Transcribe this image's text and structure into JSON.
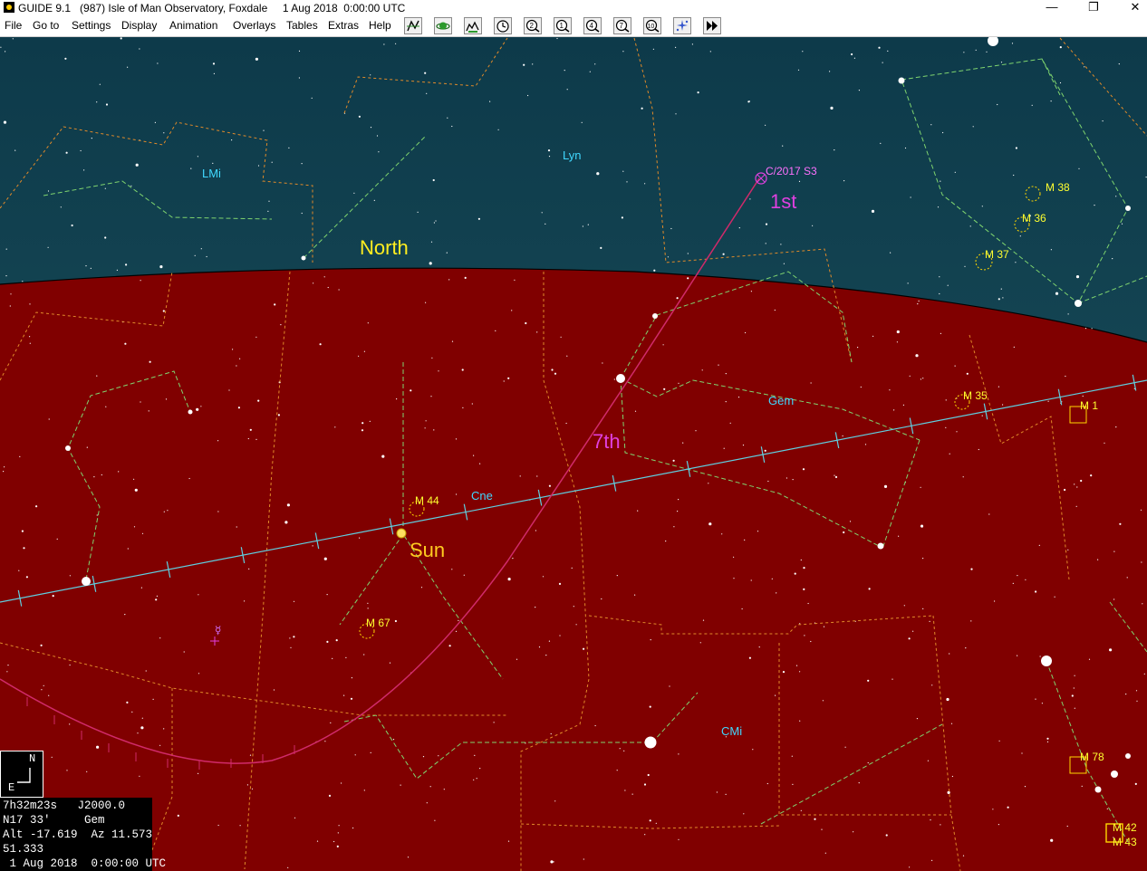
{
  "window": {
    "app_name": "GUIDE 9.1",
    "title_rest": "(987) Isle of Man Observatory, Foxdale     1 Aug 2018  0:00:00 UTC",
    "minimize": "—",
    "maximize": "❐",
    "close": "✕"
  },
  "menu": [
    "File",
    "Go to",
    "Settings",
    "Display",
    "Animation",
    "Overlays",
    "Tables",
    "Extras",
    "Help"
  ],
  "toolbar": [
    "chart-icon",
    "planet-icon",
    "telescope-icon",
    "clock-icon",
    "zoom-2-icon",
    "zoom-1-icon",
    "zoom-4-icon",
    "zoom-7-icon",
    "zoom-10-icon",
    "star-sparkle-icon",
    "fast-forward-icon"
  ],
  "sky": {
    "sky_color": "#143a48",
    "horizon_color": "#800000",
    "horizon_label": "North",
    "constellations": [
      "LMi",
      "Lyn",
      "Gem",
      "Cne",
      "CMi"
    ],
    "messier": [
      "M 38",
      "M 36",
      "M 37",
      "M 35",
      "M 1",
      "M 44",
      "M 67",
      "M 78",
      "M 42",
      "M 43"
    ],
    "comet_label": "C/2017 S3",
    "comet_markers": [
      "1st",
      "7th"
    ],
    "sun_label": "Sun"
  },
  "compass": {
    "north": "N",
    "east": "E"
  },
  "info": {
    "line1": "7h32m23s   J2000.0",
    "line2": "N17 33'     Gem",
    "line3": "Alt -17.619  Az 11.573",
    "line4": "51.333",
    "line5": " 1 Aug 2018  0:00:00 UTC"
  }
}
